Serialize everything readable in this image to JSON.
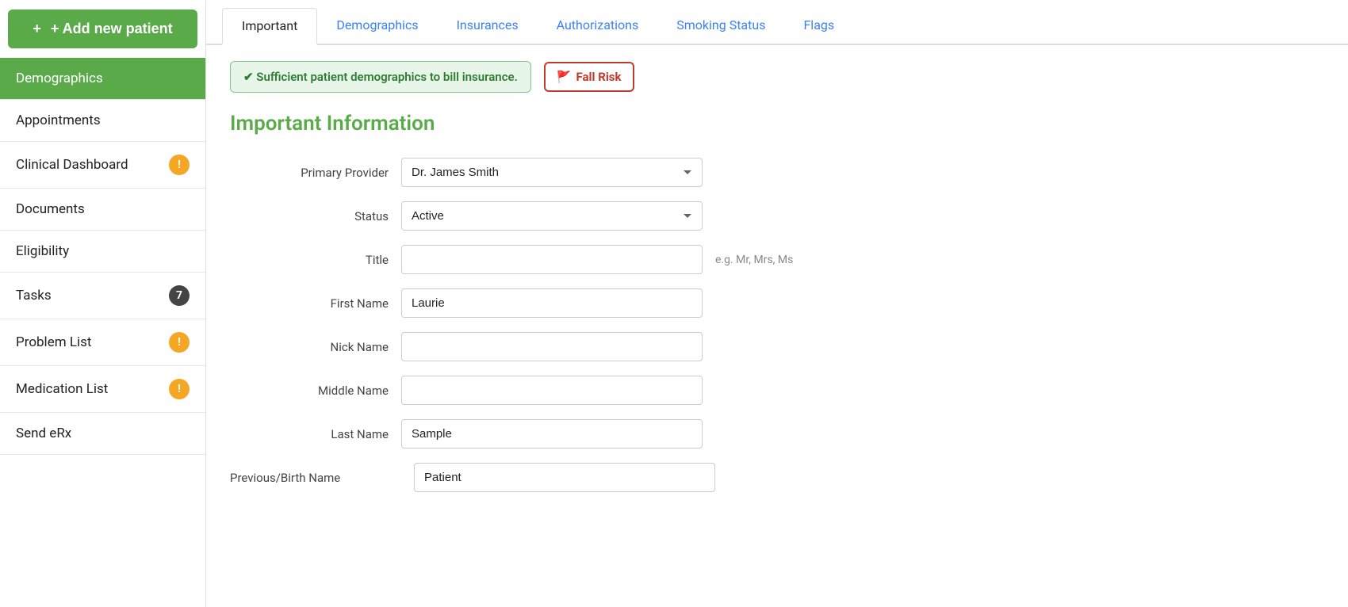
{
  "sidebar": {
    "add_button_label": "+ Add new patient",
    "items": [
      {
        "id": "demographics",
        "label": "Demographics",
        "active": true,
        "badge": null
      },
      {
        "id": "appointments",
        "label": "Appointments",
        "active": false,
        "badge": null
      },
      {
        "id": "clinical-dashboard",
        "label": "Clinical Dashboard",
        "active": false,
        "badge": "yellow"
      },
      {
        "id": "documents",
        "label": "Documents",
        "active": false,
        "badge": null
      },
      {
        "id": "eligibility",
        "label": "Eligibility",
        "active": false,
        "badge": null
      },
      {
        "id": "tasks",
        "label": "Tasks",
        "active": false,
        "badge": "dark",
        "badge_count": "7"
      },
      {
        "id": "problem-list",
        "label": "Problem List",
        "active": false,
        "badge": "yellow"
      },
      {
        "id": "medication-list",
        "label": "Medication List",
        "active": false,
        "badge": "yellow"
      },
      {
        "id": "send-erx",
        "label": "Send eRx",
        "active": false,
        "badge": null
      }
    ]
  },
  "tabs": [
    {
      "id": "important",
      "label": "Important",
      "active": true
    },
    {
      "id": "demographics",
      "label": "Demographics",
      "active": false
    },
    {
      "id": "insurances",
      "label": "Insurances",
      "active": false
    },
    {
      "id": "authorizations",
      "label": "Authorizations",
      "active": false
    },
    {
      "id": "smoking-status",
      "label": "Smoking Status",
      "active": false
    },
    {
      "id": "flags",
      "label": "Flags",
      "active": false
    }
  ],
  "status": {
    "success_message": "✔ Sufficient patient demographics to bill insurance.",
    "fall_risk_label": "Fall Risk"
  },
  "form": {
    "section_title": "Important Information",
    "fields": [
      {
        "id": "primary-provider",
        "label": "Primary Provider",
        "type": "select",
        "value": "Dr. James Smith",
        "hint": ""
      },
      {
        "id": "status",
        "label": "Status",
        "type": "select",
        "value": "Active",
        "hint": ""
      },
      {
        "id": "title",
        "label": "Title",
        "type": "text",
        "value": "",
        "hint": "e.g. Mr, Mrs, Ms"
      },
      {
        "id": "first-name",
        "label": "First Name",
        "type": "text",
        "value": "Laurie",
        "hint": ""
      },
      {
        "id": "nick-name",
        "label": "Nick Name",
        "type": "text",
        "value": "",
        "hint": ""
      },
      {
        "id": "middle-name",
        "label": "Middle Name",
        "type": "text",
        "value": "",
        "hint": ""
      },
      {
        "id": "last-name",
        "label": "Last Name",
        "type": "text",
        "value": "Sample",
        "hint": ""
      }
    ],
    "arrow_field": {
      "id": "previous-birth-name",
      "label": "Previous/Birth Name",
      "type": "text",
      "value": "Patient",
      "hint": ""
    }
  },
  "icons": {
    "plus": "+",
    "flag": "🚩",
    "exclamation": "!"
  }
}
